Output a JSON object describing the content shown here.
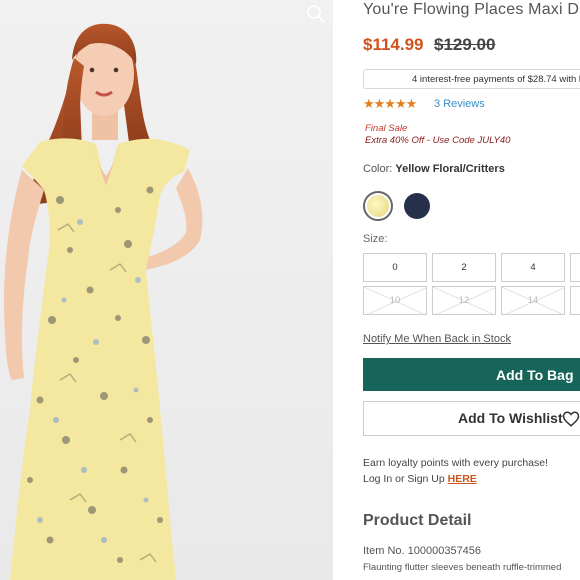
{
  "product": {
    "title": "You're Flowing Places Maxi D",
    "price": "$114.99",
    "original_price": "$129.00",
    "installments_text": "4 interest-free payments of $28.74 with ",
    "installments_brand": "Kl",
    "rating": {
      "stars": "★★★★★",
      "reviews_label": "3 Reviews"
    },
    "sale_label": "Final Sale",
    "promo_text": "Extra 40% Off - Use Code JULY40",
    "color_label": "Color:",
    "color_value": "Yellow Floral/Critters",
    "swatches": [
      {
        "name": "Yellow Floral/Critters",
        "color": "#efe39a",
        "selected": true
      },
      {
        "name": "Navy",
        "color": "#27304a",
        "selected": false
      }
    ],
    "size_label": "Size:",
    "sizes": [
      {
        "label": "0",
        "available": true
      },
      {
        "label": "2",
        "available": true
      },
      {
        "label": "4",
        "available": true
      },
      {
        "label": "10",
        "available": false
      },
      {
        "label": "12",
        "available": false
      },
      {
        "label": "14",
        "available": false
      }
    ],
    "notify_label": "Notify Me When Back in Stock",
    "add_to_bag_label": "Add To Bag",
    "add_to_wishlist_label": "Add To Wishlist",
    "loyalty_line1": "Earn loyalty points with every purchase!",
    "loyalty_line2_prefix": "Log In or Sign Up ",
    "loyalty_link": "HERE",
    "detail_title": "Product Detail",
    "item_number": "Item No. 100000357456",
    "description": "Flaunting flutter sleeves beneath ruffle-trimmed"
  },
  "colors": {
    "accent": "#17645a",
    "price": "#d3521c",
    "stars": "#e2801e",
    "link": "#3a8fc7",
    "sale": "#c0392b"
  },
  "icons": {
    "zoom": "zoom-icon",
    "heart": "heart-icon",
    "star": "star-icon"
  }
}
